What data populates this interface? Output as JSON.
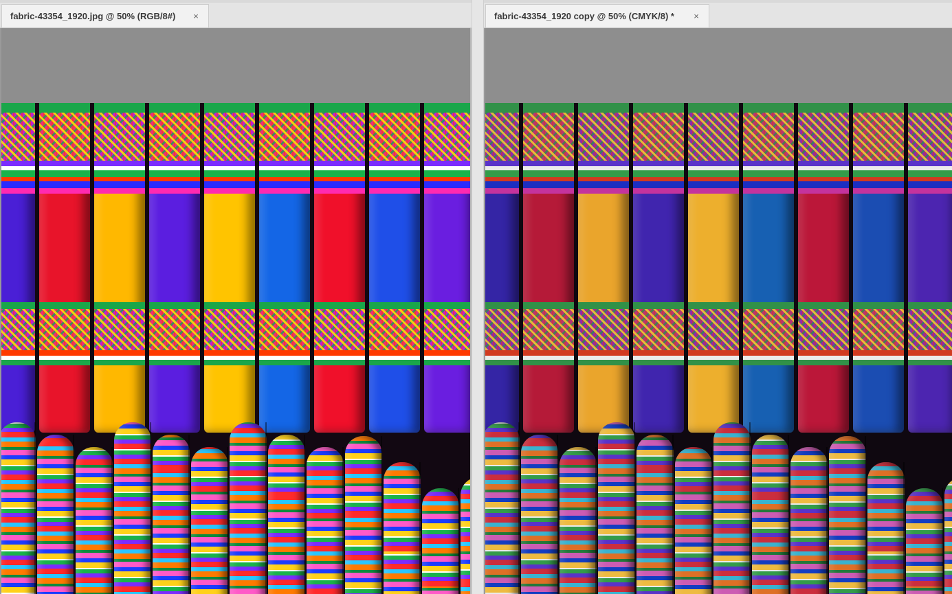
{
  "documents": [
    {
      "id": "left",
      "tab_label": "fabric-43354_1920.jpg @ 50% (RGB/8#)",
      "close_glyph": "×",
      "color_mode": "RGB"
    },
    {
      "id": "right",
      "tab_label": "fabric-43354_1920 copy @ 50% (CMYK/8) *",
      "close_glyph": "×",
      "color_mode": "CMYK"
    }
  ],
  "icons": {
    "close": "close-icon"
  },
  "colors": {
    "pasteboard": "#8e8e8e",
    "tab_bg": "#f2f2f2",
    "tabbar_bg": "#e4e4e4"
  }
}
